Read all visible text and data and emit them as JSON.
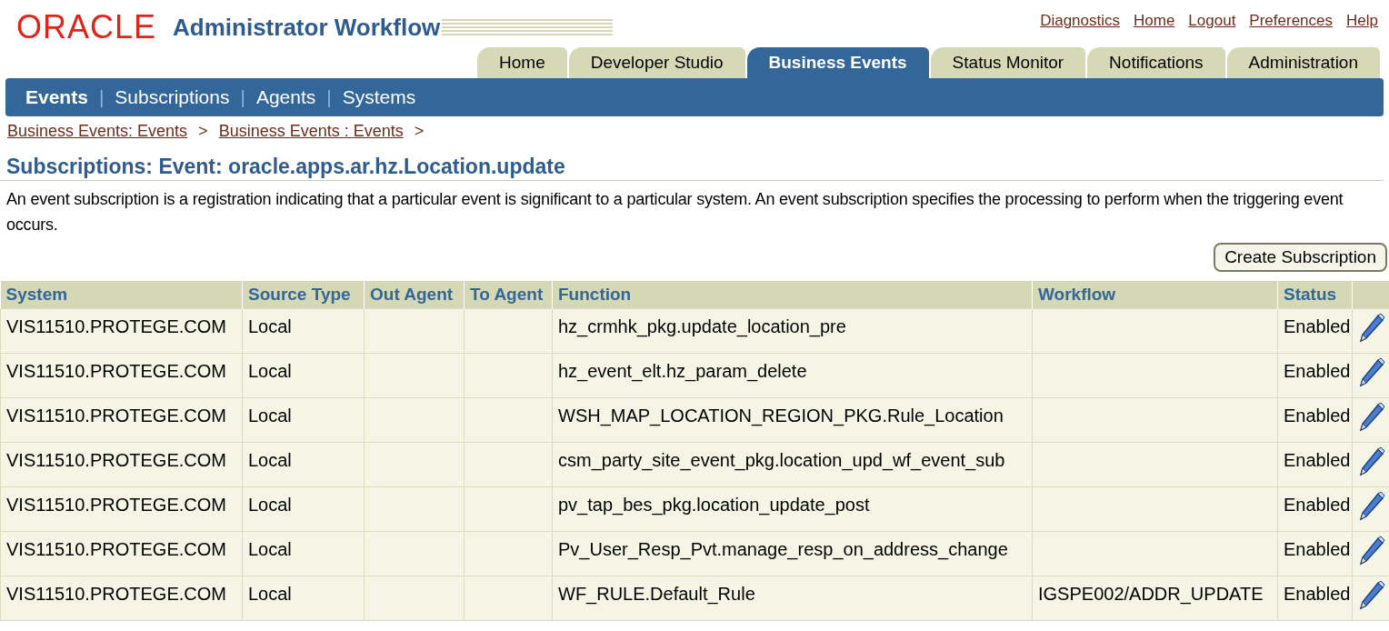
{
  "header": {
    "logo": "ORACLE",
    "app_title": "Administrator Workflow",
    "global_links": [
      "Diagnostics",
      "Home",
      "Logout",
      "Preferences",
      "Help"
    ]
  },
  "tabs": [
    {
      "label": "Home",
      "selected": false
    },
    {
      "label": "Developer Studio",
      "selected": false
    },
    {
      "label": "Business Events",
      "selected": true
    },
    {
      "label": "Status Monitor",
      "selected": false
    },
    {
      "label": "Notifications",
      "selected": false
    },
    {
      "label": "Administration",
      "selected": false
    }
  ],
  "subtabs": [
    {
      "label": "Events",
      "selected": true
    },
    {
      "label": "Subscriptions",
      "selected": false
    },
    {
      "label": "Agents",
      "selected": false
    },
    {
      "label": "Systems",
      "selected": false
    }
  ],
  "subtab_separator": "|",
  "breadcrumbs": [
    "Business Events: Events",
    "Business Events : Events"
  ],
  "breadcrumb_separator": ">",
  "page_title": "Subscriptions: Event: oracle.apps.ar.hz.Location.update",
  "description": "An event subscription is a registration indicating that a particular event is significant to a particular system. An event subscription specifies the processing to perform when the triggering event occurs.",
  "create_button": "Create Subscription",
  "table": {
    "columns": [
      "System",
      "Source Type",
      "Out Agent",
      "To Agent",
      "Function",
      "Workflow",
      "Status"
    ],
    "rows": [
      {
        "system": "VIS11510.PROTEGE.COM",
        "source_type": "Local",
        "function": "hz_crmhk_pkg.update_location_pre",
        "status": "Enabled"
      },
      {
        "system": "VIS11510.PROTEGE.COM",
        "source_type": "Local",
        "function": "hz_event_elt.hz_param_delete",
        "status": "Enabled"
      },
      {
        "system": "VIS11510.PROTEGE.COM",
        "source_type": "Local",
        "function": "WSH_MAP_LOCATION_REGION_PKG.Rule_Location",
        "status": "Enabled"
      },
      {
        "system": "VIS11510.PROTEGE.COM",
        "source_type": "Local",
        "function": "csm_party_site_event_pkg.location_upd_wf_event_sub",
        "status": "Enabled"
      },
      {
        "system": "VIS11510.PROTEGE.COM",
        "source_type": "Local",
        "function": "pv_tap_bes_pkg.location_update_post",
        "status": "Enabled"
      },
      {
        "system": "VIS11510.PROTEGE.COM",
        "source_type": "Local",
        "function": "Pv_User_Resp_Pvt.manage_resp_on_address_change",
        "status": "Enabled"
      },
      {
        "system": "VIS11510.PROTEGE.COM",
        "source_type": "Local",
        "function": "WF_RULE.Default_Rule",
        "workflow": "IGSPE002/ADDR_UPDATE",
        "status": "Enabled"
      }
    ]
  }
}
